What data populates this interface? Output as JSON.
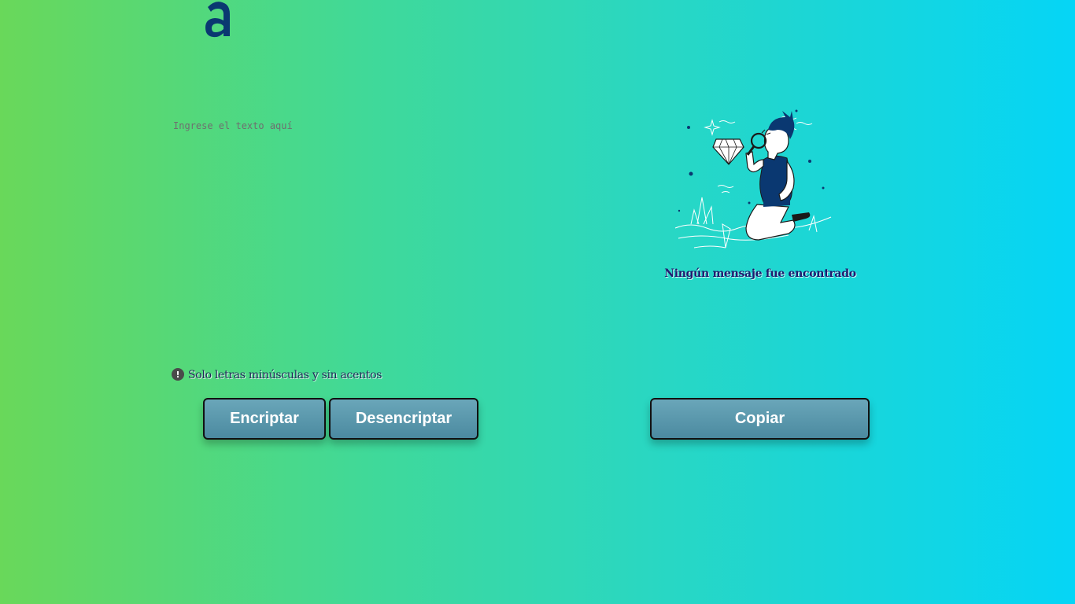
{
  "logo": {
    "icon": "alura-a-logo",
    "color": "#0a3871"
  },
  "input": {
    "placeholder": "Ingrese el texto aquí",
    "value": ""
  },
  "hint": {
    "icon": "exclamation-circle-icon",
    "text": "Solo letras minúsculas y sin acentos"
  },
  "buttons": {
    "encrypt_label": "Encriptar",
    "decrypt_label": "Desencriptar",
    "copy_label": "Copiar"
  },
  "output": {
    "illustration": "person-with-magnifier-illustration",
    "empty_message": "Ningún mensaje fue encontrado"
  },
  "colors": {
    "gradient_left": "#69d85a",
    "gradient_right": "#05d5f6",
    "button_top": "#6aa6b9",
    "button_bottom": "#4b8aa0",
    "brand_dark": "#0a3871"
  }
}
